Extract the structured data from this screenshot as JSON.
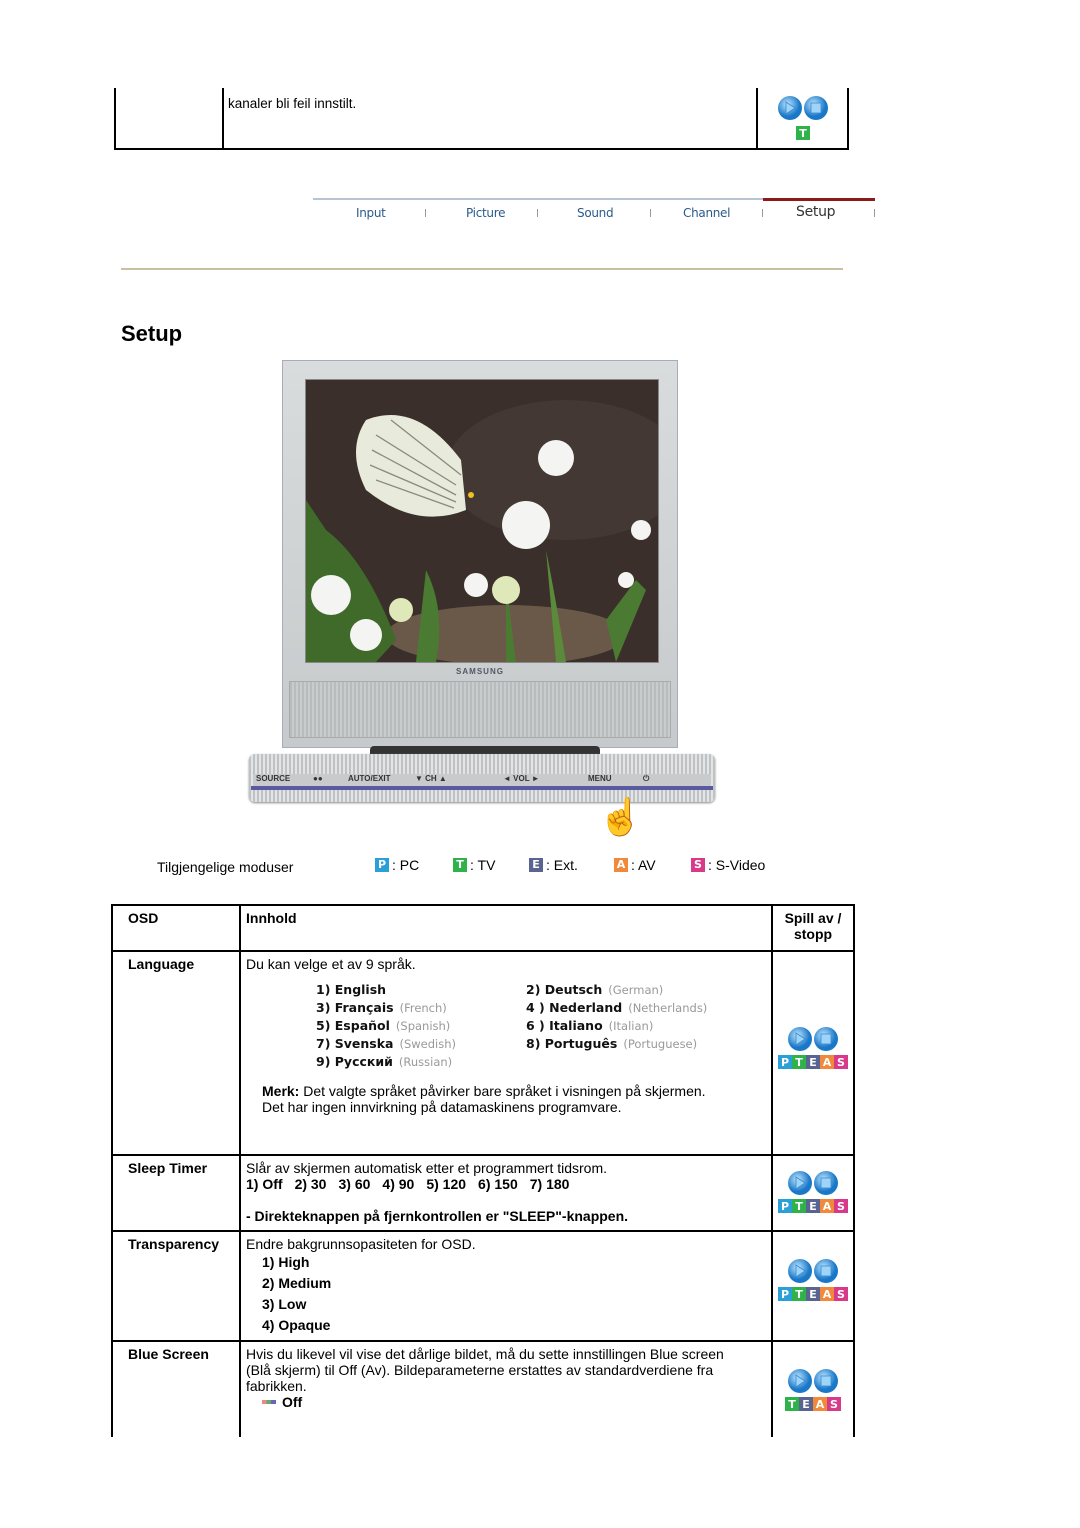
{
  "top_fragment": {
    "text": "kanaler bli feil innstilt.",
    "modes": [
      "T"
    ]
  },
  "nav": {
    "items": [
      {
        "label": "Input",
        "active": false
      },
      {
        "label": "Picture",
        "active": false
      },
      {
        "label": "Sound",
        "active": false
      },
      {
        "label": "Channel",
        "active": false
      },
      {
        "label": "Setup",
        "active": true
      }
    ]
  },
  "page_title": "Setup",
  "monitor": {
    "brand": "SAMSUNG",
    "controls": [
      "SOURCE",
      "AUTO/EXIT",
      "▼ CH ▲",
      "◄ VOL ►",
      "MENU",
      "⏻"
    ]
  },
  "modes": {
    "label": "Tilgjengelige moduser",
    "items": [
      {
        "badge": "P",
        "label": ": PC",
        "color": "#2a9fd8"
      },
      {
        "badge": "T",
        "label": ": TV",
        "color": "#2fb24a"
      },
      {
        "badge": "E",
        "label": ": Ext.",
        "color": "#5a6490"
      },
      {
        "badge": "A",
        "label": ": AV",
        "color": "#f08a3a"
      },
      {
        "badge": "S",
        "label": ": S-Video",
        "color": "#d83a8a"
      }
    ]
  },
  "table": {
    "headers": {
      "osd": "OSD",
      "content": "Innhold",
      "play": "Spill av / stopp"
    },
    "rows": [
      {
        "osd": "Language",
        "intro": "Du kan velge et av 9 språk.",
        "languages": [
          {
            "num": "1)",
            "name": "English",
            "en": ""
          },
          {
            "num": "2)",
            "name": "Deutsch",
            "en": "(German)"
          },
          {
            "num": "3)",
            "name": "Français",
            "en": "(French)"
          },
          {
            "num": "4 )",
            "name": "Nederland",
            "en": "(Netherlands)"
          },
          {
            "num": "5)",
            "name": "Español",
            "en": "(Spanish)"
          },
          {
            "num": "6 )",
            "name": "Italiano",
            "en": "(Italian)"
          },
          {
            "num": "7)",
            "name": "Svenska",
            "en": "(Swedish)"
          },
          {
            "num": "8)",
            "name": "Português",
            "en": "(Portuguese)"
          },
          {
            "num": "9)",
            "name": "Русский",
            "en": "(Russian)"
          }
        ],
        "note_label": "Merk:",
        "note": " Det valgte språket påvirker bare språket i visningen på skjermen.",
        "note2": "Det har ingen innvirkning på datamaskinens programvare.",
        "modes": "PTEAS"
      },
      {
        "osd": "Sleep Timer",
        "intro": "Slår av skjermen automatisk etter et programmert tidsrom.",
        "options": [
          "1) Off",
          "2) 30",
          "3) 60",
          "4) 90",
          "5) 120",
          "6) 150",
          "7) 180"
        ],
        "note": "- Direkteknappen på fjernkontrollen er \"SLEEP\"-knappen.",
        "modes": "PTEAS"
      },
      {
        "osd": "Transparency",
        "intro": "Endre bakgrunnsopasiteten for OSD.",
        "options": [
          "1) High",
          "2) Medium",
          "3) Low",
          "4) Opaque"
        ],
        "modes": "PTEAS"
      },
      {
        "osd": "Blue Screen",
        "intro": "Hvis du likevel vil vise det dårlige bildet, må du sette innstillingen Blue screen (Blå skjerm) til Off (Av). Bildeparameterne erstattes av standardverdiene fra fabrikken.",
        "value": "Off",
        "modes": "TEAS"
      }
    ]
  },
  "badge_colors": {
    "P": "#2a9fd8",
    "T": "#2fb24a",
    "E": "#5a6490",
    "A": "#f08a3a",
    "S": "#d83a8a"
  }
}
